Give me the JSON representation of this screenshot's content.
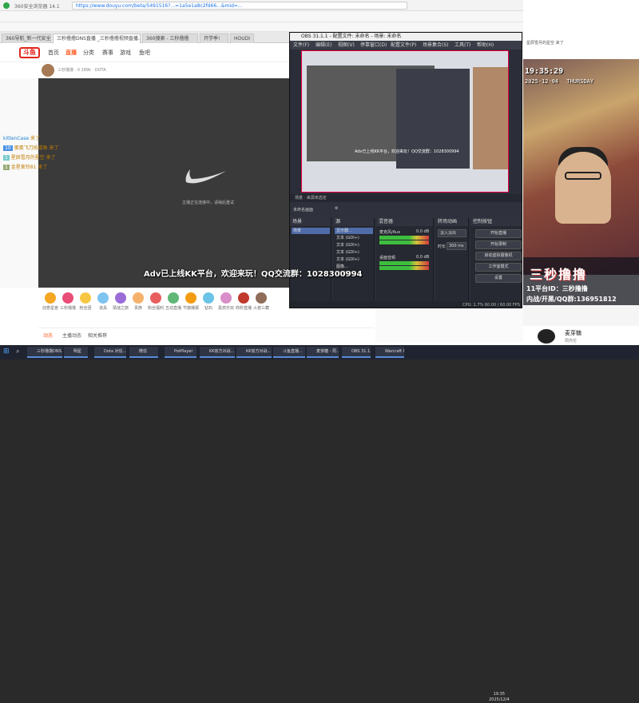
{
  "browser": {
    "app_name": "360安全浏览器 14.1",
    "url": "https://www.douyu.com/beta/5491516?...=1a5e1a8c2fd66...&mid=...",
    "tabs": [
      {
        "label": "360导航_新一代安全上网导航"
      },
      {
        "label": "三秒撸撸DNS直播 _三秒撸撸视频直播..."
      },
      {
        "label": "360搜索 - 三秒撸撸"
      },
      {
        "label": "开学季!"
      },
      {
        "label": "HOUDI"
      }
    ],
    "nav": [
      "首页",
      "直播",
      "分类",
      "赛事",
      "游戏",
      "鱼吧"
    ],
    "logo": "斗鱼",
    "channel_line": "三秒撸撸 · 0 189k · DOTA",
    "loading_text": "主播正在连接中，请稍后重试"
  },
  "danmaku": [
    {
      "user": "kittenCase",
      "text": "来了"
    },
    {
      "user": "10",
      "text": "蛋蛋飞刀拍咸鱼 来了"
    },
    {
      "user": "1",
      "text": "星辰雪月的星空 来了"
    },
    {
      "user": "1",
      "text": "金星美铃81 来了"
    }
  ],
  "gifts": [
    "创意星宫",
    "三秒撸撸",
    "粉丝团",
    "道具",
    "猜谜之旅",
    "贵族",
    "粉丝福利",
    "五动直播",
    "节旗播报",
    "钻石",
    "嘉宾乐玩",
    "商秒直播",
    "火遮三藏"
  ],
  "bottom_tabs": [
    "动态",
    "主播动态",
    "相关推荐"
  ],
  "obs": {
    "title": "OBS 31.1.1 - 配置文件: 未命名 - 场景: 未命名",
    "menu": [
      "文件(F)",
      "编辑(E)",
      "视图(V)",
      "停靠窗口(D)",
      "配置文件(P)",
      "场景集合(S)",
      "工具(T)",
      "帮助(H)"
    ],
    "scenebar": "场景  · 来源未选定",
    "toolbar_label": "未命名画面",
    "docks": {
      "scenes": {
        "title": "场景",
        "items": [
          "场景"
        ]
      },
      "sources": {
        "title": "源",
        "items": [
          "显示器…",
          "文本 (GDI+)",
          "文本 (GDI+)",
          "文本 (GDI+)",
          "文本 (GDI+)",
          "图像…",
          "媒体源 2"
        ]
      },
      "mixer": {
        "title": "混音器",
        "channels": [
          {
            "name": "麦克风/Aux",
            "db": "0.0 dB"
          },
          {
            "name": "桌面音频",
            "db": "0.0 dB"
          }
        ]
      },
      "transitions": {
        "title": "转场动画",
        "type": "淡入淡出",
        "duration_label": "时长",
        "duration": "300 ms"
      },
      "controls": {
        "title": "控制按钮",
        "buttons": [
          "开始直播",
          "开始录制",
          "启动虚拟摄像机",
          "工作室模式",
          "设置"
        ]
      }
    },
    "status": "CPU: 1.7%   60.00 / 60.00 FPS"
  },
  "banner": "Adv已上线KK平台，欢迎来玩！QQ交流群：1028300994",
  "overlay": {
    "time": "19:35:29",
    "date": "2025-12-04",
    "weekday": "THURSDAY",
    "streamer": "三秒撸撸",
    "room_line": "11平台ID：三秒撸撸",
    "qq_line": "内战/开黑/QQ群:136951812"
  },
  "music": {
    "title": "麦芽糖",
    "artist": "周杰伦"
  },
  "right_top": {
    "label": "星辰雪月的星空 来了"
  },
  "taskbar": {
    "items": [
      "三秒撸撸DNS...",
      "明星",
      "Dota 对信...",
      "微信",
      "PotPlayer",
      "KK官方对战...",
      "KK官方对战...",
      "斗鱼直播...",
      "麦芽糖 - 周...",
      "OBS 31.1.1...",
      "Warcraft III"
    ],
    "time": "19:35",
    "date": "2025/12/4"
  },
  "colors": {
    "accent": "#ff5d23",
    "obs_bg": "#2b2e38",
    "taskbar": "#1f2430"
  }
}
